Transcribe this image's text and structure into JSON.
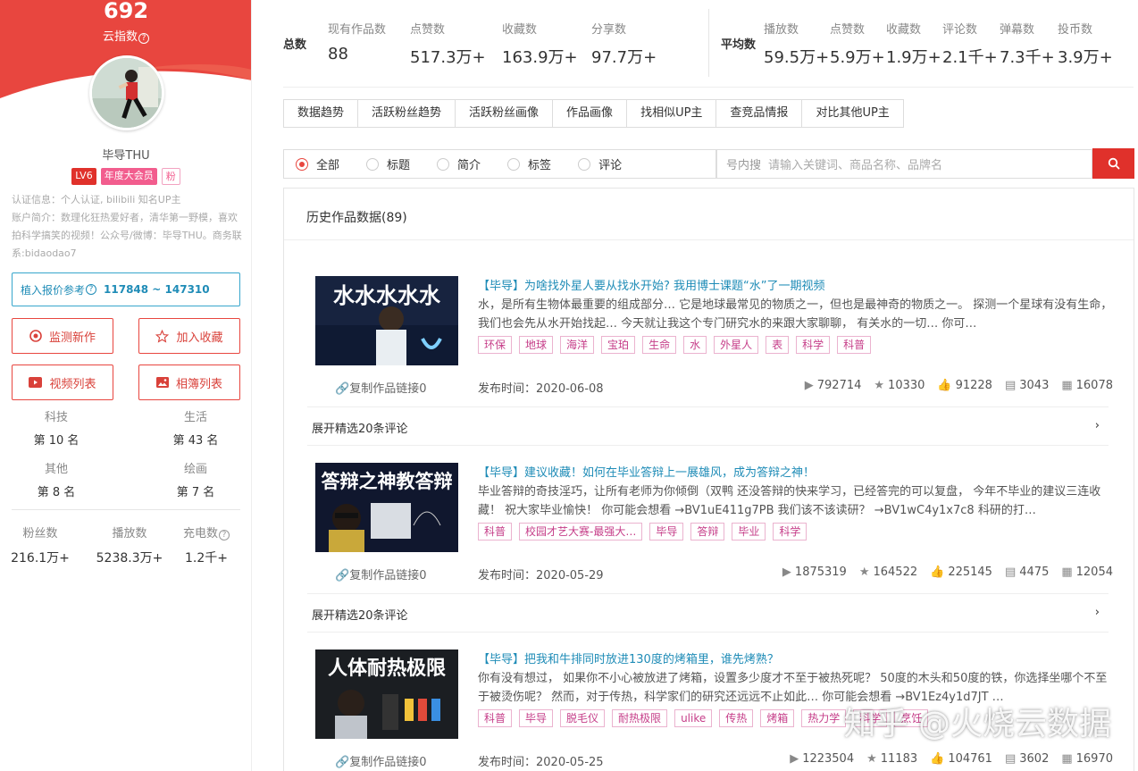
{
  "profile": {
    "cloud_index": "692",
    "cloud_index_label": "云指数",
    "name": "毕导THU",
    "badge_level": "LV6",
    "badge_vip": "年度大会员",
    "badge_fan": "粉",
    "cert": "认证信息：个人认证, bilibili 知名UP主",
    "intro": "账户简介：数理化狂热爱好者，清华第一野模，喜欢拍科学搞笑的视频！公众号/微博：毕导THU。商务联系:bidaodao7",
    "quote_label": "植入报价参考",
    "quote_range": "117848 ~ 147310",
    "buttons": {
      "monitor": "监测新作",
      "favorite": "加入收藏",
      "videos": "视频列表",
      "albums": "相簿列表"
    },
    "ranks": [
      {
        "category": "科技",
        "position": "第 10 名"
      },
      {
        "category": "生活",
        "position": "第 43 名"
      },
      {
        "category": "其他",
        "position": "第 8 名"
      },
      {
        "category": "绘画",
        "position": "第 7 名"
      }
    ],
    "fans": [
      {
        "label": "粉丝数",
        "value": "216.1万+"
      },
      {
        "label": "播放数",
        "value": "5238.3万+"
      },
      {
        "label": "充电数",
        "value": "1.2千+"
      }
    ]
  },
  "stats": {
    "total_label": "总数",
    "avg_label": "平均数",
    "total": [
      {
        "label": "现有作品数",
        "value": "88"
      },
      {
        "label": "点赞数",
        "value": "517.3万+"
      },
      {
        "label": "收藏数",
        "value": "163.9万+"
      },
      {
        "label": "分享数",
        "value": "97.7万+"
      }
    ],
    "avg": [
      {
        "label": "播放数",
        "value": "59.5万+"
      },
      {
        "label": "点赞数",
        "value": "5.9万+"
      },
      {
        "label": "收藏数",
        "value": "1.9万+"
      },
      {
        "label": "评论数",
        "value": "2.1千+"
      },
      {
        "label": "弹幕数",
        "value": "7.3千+"
      },
      {
        "label": "投币数",
        "value": "3.9万+"
      }
    ]
  },
  "tabs": [
    "数据趋势",
    "活跃粉丝趋势",
    "活跃粉丝画像",
    "作品画像",
    "找相似UP主",
    "查竞品情报",
    "对比其他UP主"
  ],
  "filter": {
    "options": [
      "全部",
      "标题",
      "简介",
      "标签",
      "评论"
    ],
    "selected": "全部",
    "search_prefix": "号内搜",
    "search_placeholder": "请输入关键词、商品名称、品牌名"
  },
  "history": {
    "title": "历史作品数据(89)",
    "copy_link": "复制作品链接0",
    "pub_prefix": "发布时间：",
    "expand_label": "展开精选20条评论",
    "videos": [
      {
        "thumb_text": "水水水水水",
        "title": "【毕导】为啥找外星人要从找水开始? 我用博士课题“水”了一期视频",
        "desc": "水，是所有生物体最重要的组成部分… 它是地球最常见的物质之一，但也是最神奇的物质之一。 探测一个星球有没有生命，我们也会先从水开始找起… 今天就让我这个专门研究水的来跟大家聊聊， 有关水的一切… 你可…",
        "tags": [
          "环保",
          "地球",
          "海洋",
          "宝珀",
          "生命",
          "水",
          "外星人",
          "表",
          "科学",
          "科普"
        ],
        "date": "2020-06-08",
        "plays": "792714",
        "stars": "10330",
        "likes": "91228",
        "comments": "3043",
        "danmaku": "16078"
      },
      {
        "thumb_text": "答辩之神教答辩",
        "title": "【毕导】建议收藏！如何在毕业答辩上一展雄风，成为答辩之神！",
        "desc": "毕业答辩的奇技淫巧，让所有老师为你倾倒（双鸭 还没答辩的快来学习，已经答完的可以复盘， 今年不毕业的建议三连收藏！ 祝大家毕业愉快！ 你可能会想看 →BV1uE411g7PB 我们该不该读研？ →BV1wC4y1x7c8 科研的打…",
        "tags": [
          "科普",
          "校园才艺大赛-最强大…",
          "毕导",
          "答辩",
          "毕业",
          "科学"
        ],
        "date": "2020-05-29",
        "plays": "1875319",
        "stars": "164522",
        "likes": "225145",
        "comments": "4475",
        "danmaku": "12054"
      },
      {
        "thumb_text": "人体耐热极限",
        "title": "【毕导】把我和牛排同时放进130度的烤箱里，谁先烤熟？",
        "desc": "你有没有想过， 如果你不小心被放进了烤箱，设置多少度才不至于被热死呢？ 50度的木头和50度的铁，你选择坐哪个不至于被烫伤呢？ 然而，对于传热，科学家们的研究还远远不止如此… 你可能会想看 →BV1Ez4y1d7JT …",
        "tags": [
          "科普",
          "毕导",
          "脱毛仪",
          "耐热极限",
          "ulike",
          "传热",
          "烤箱",
          "热力学",
          "科学",
          "烹饪"
        ],
        "date": "2020-05-25",
        "plays": "1223504",
        "stars": "11183",
        "likes": "104761",
        "comments": "3602",
        "danmaku": "16970"
      }
    ]
  },
  "watermark": "知乎 @火烧云数据",
  "colors": {
    "accent": "#e8463f",
    "link": "#1f8cb7",
    "tag": "#c63e89"
  }
}
